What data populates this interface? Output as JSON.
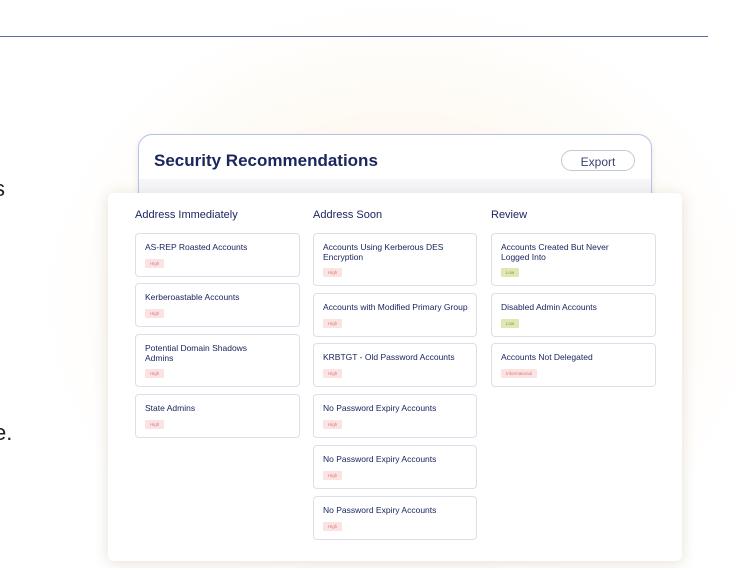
{
  "edge_text": [
    "s",
    "e."
  ],
  "back_card": {
    "title": "Security Recommendations",
    "export_label": "Export"
  },
  "columns": [
    {
      "title": "Address Immediately",
      "items": [
        {
          "label": "AS-REP Roasted Accounts",
          "badge": "High",
          "level": "high"
        },
        {
          "label": "Kerberoastable Accounts",
          "badge": "High",
          "level": "high"
        },
        {
          "label": "Potential Domain Shadows Admins",
          "badge": "High",
          "level": "high"
        },
        {
          "label": "State Admins",
          "badge": "High",
          "level": "high"
        }
      ]
    },
    {
      "title": "Address Soon",
      "items": [
        {
          "label": "Accounts Using Kerberous DES Encryption",
          "badge": "High",
          "level": "high"
        },
        {
          "label": "Accounts with Modified Primary Group",
          "badge": "High",
          "level": "high"
        },
        {
          "label": "KRBTGT - Old Password Accounts",
          "badge": "High",
          "level": "high"
        },
        {
          "label": "No Password Expiry Accounts",
          "badge": "High",
          "level": "high"
        },
        {
          "label": "No Password Expiry Accounts",
          "badge": "High",
          "level": "high"
        },
        {
          "label": "No Password Expiry Accounts",
          "badge": "High",
          "level": "high"
        }
      ]
    },
    {
      "title": "Review",
      "items": [
        {
          "label": "Accounts Created But Never Logged Into",
          "badge": "Low",
          "level": "low"
        },
        {
          "label": "Disabled Admin Accounts",
          "badge": "Low",
          "level": "low"
        },
        {
          "label": "Accounts Not Delegated",
          "badge": "Informational",
          "level": "info"
        }
      ]
    }
  ],
  "colors": {
    "high_bg": "#fbe3e3",
    "low_bg": "#e1e7b4",
    "text": "#1b2660",
    "border": "#dcdfe8"
  }
}
